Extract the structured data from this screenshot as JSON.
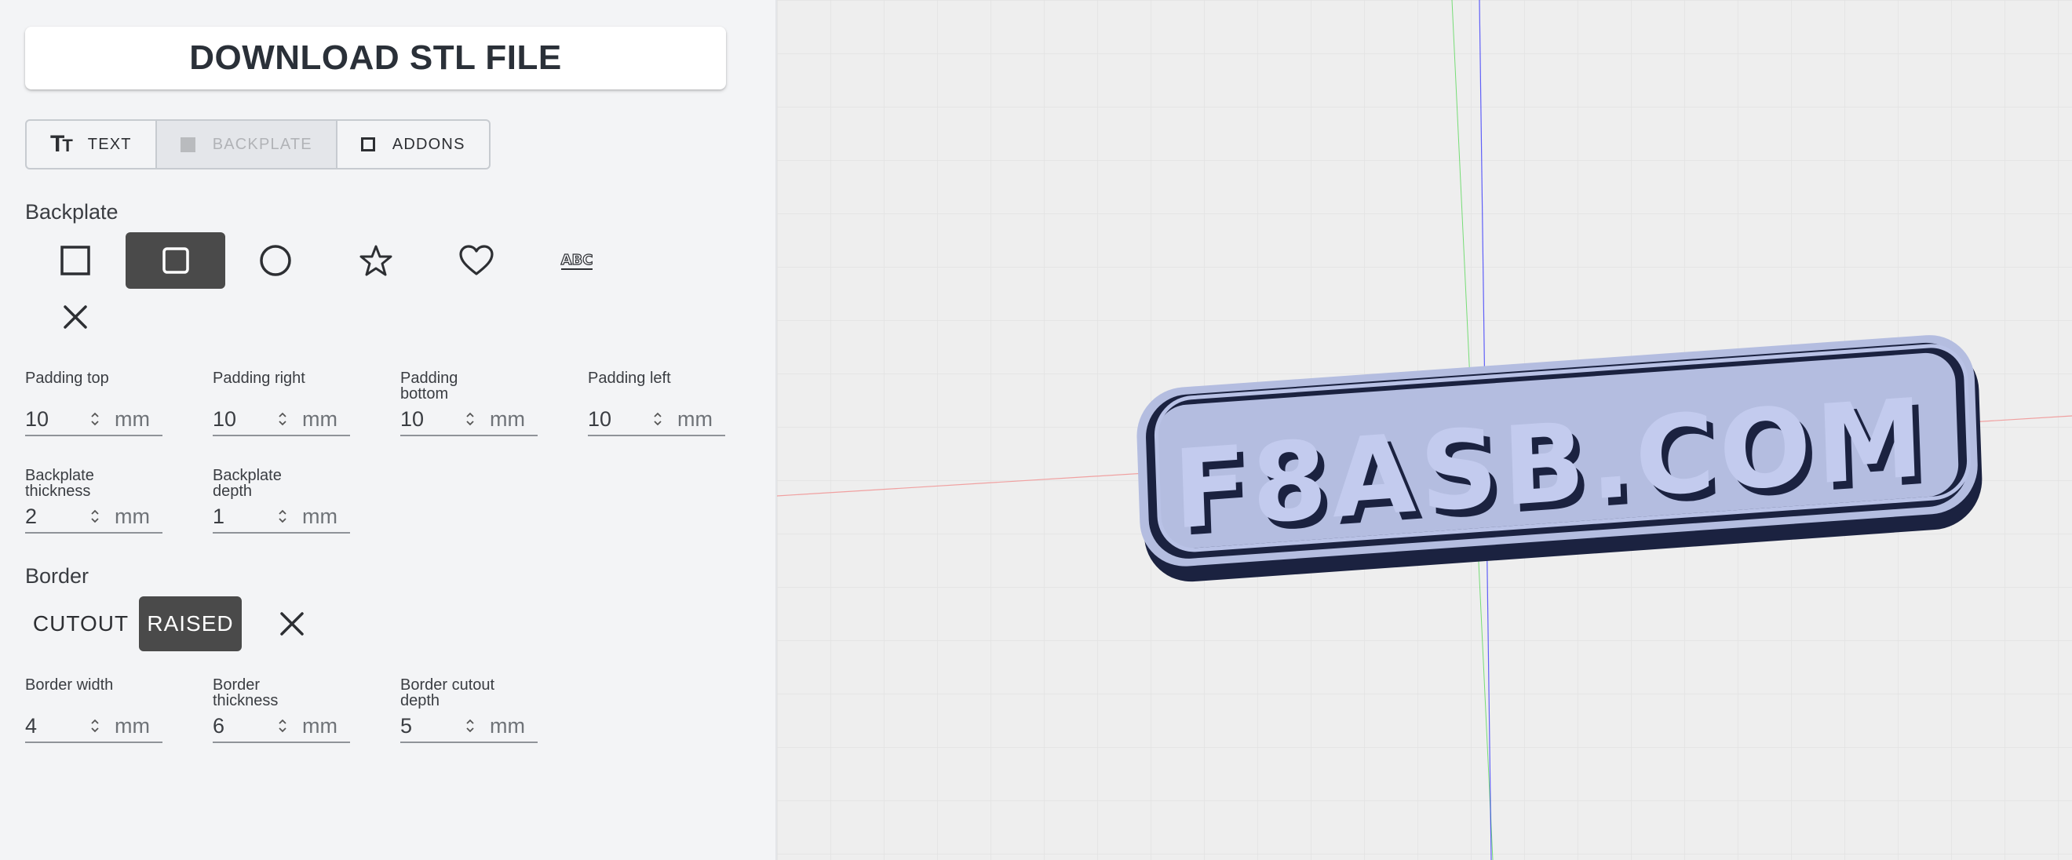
{
  "download_label": "DOWNLOAD STL FILE",
  "tabs": [
    {
      "icon": "text-size-icon",
      "label": "TEXT"
    },
    {
      "icon": "backplate-square-icon",
      "label": "BACKPLATE"
    },
    {
      "icon": "addons-square-icon",
      "label": "ADDONS"
    }
  ],
  "active_tab": "BACKPLATE",
  "backplate": {
    "title": "Backplate",
    "shapes": [
      "square-shape-icon",
      "rounded-square-shape-icon",
      "circle-shape-icon",
      "star-shape-icon",
      "heart-shape-icon",
      "text-outline-shape-icon",
      "none-close-icon"
    ],
    "shape_text_glyph": "ABC",
    "selected_shape": "rounded-square-shape-icon",
    "fields": {
      "padding_top": {
        "label": "Padding top",
        "value": "10",
        "unit": "mm"
      },
      "padding_right": {
        "label": "Padding right",
        "value": "10",
        "unit": "mm"
      },
      "padding_bottom": {
        "label": "Padding bottom",
        "value": "10",
        "unit": "mm"
      },
      "padding_left": {
        "label": "Padding left",
        "value": "10",
        "unit": "mm"
      },
      "thickness": {
        "label": "Backplate thickness",
        "value": "2",
        "unit": "mm"
      },
      "depth": {
        "label": "Backplate depth",
        "value": "1",
        "unit": "mm"
      }
    }
  },
  "border": {
    "title": "Border",
    "options": [
      "CUTOUT",
      "RAISED"
    ],
    "selected": "RAISED",
    "fields": {
      "width": {
        "label": "Border width",
        "value": "4",
        "unit": "mm"
      },
      "thickness": {
        "label": "Border thickness",
        "value": "6",
        "unit": "mm"
      },
      "cutout_depth": {
        "label": "Border cutout depth",
        "value": "5",
        "unit": "mm"
      }
    }
  },
  "preview": {
    "text": "F8ASB.COM",
    "colors": {
      "plate": "#b4bde0",
      "border": "#1b2240",
      "letters": "#c3cbee",
      "letter_shadow": "#1b2240"
    },
    "axes": {
      "x": "#f0a0a0",
      "y": "#00cc00",
      "z": "#0000ff"
    }
  }
}
